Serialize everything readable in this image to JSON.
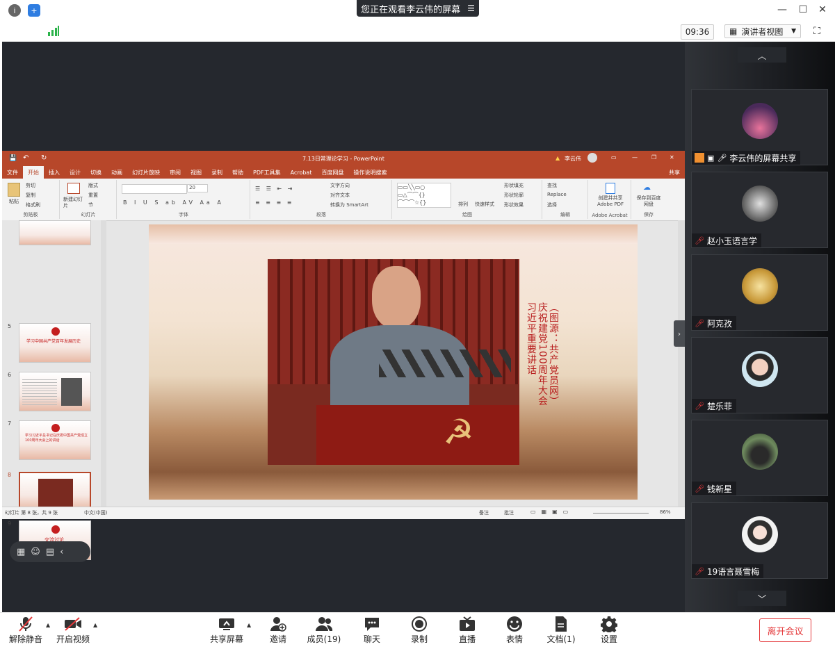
{
  "banner": {
    "text": "您正在观看李云伟的屏幕"
  },
  "infobar": {
    "clock": "09:36",
    "view_label": "演讲者视图"
  },
  "ppt": {
    "title": "7.13日常理论学习  -  PowerPoint",
    "user": "李云伟",
    "menu": [
      "文件",
      "开始",
      "插入",
      "设计",
      "切换",
      "动画",
      "幻灯片放映",
      "审阅",
      "视图",
      "录制",
      "帮助",
      "PDF工具集",
      "Acrobat",
      "百度网盘",
      "操作说明搜索"
    ],
    "share": "共享",
    "ribbon": {
      "clipboard": {
        "name": "剪贴板",
        "paste": "粘贴",
        "cut": "剪切",
        "copy": "复制",
        "format": "格式刷"
      },
      "slides": {
        "name": "幻灯片",
        "new": "新建幻灯片",
        "layout": "版式",
        "reset": "重置",
        "section": "节"
      },
      "font": {
        "name": "字体",
        "size": "20"
      },
      "paragraph": {
        "name": "段落",
        "direction": "文字方向",
        "align": "对齐文本",
        "smartart": "转换为 SmartArt"
      },
      "drawing": {
        "name": "绘图",
        "arrange": "排列",
        "quickstyle": "快速样式",
        "fill": "形状填充",
        "outline": "形状轮廓",
        "effect": "形状效果"
      },
      "editing": {
        "name": "编辑",
        "find": "查找",
        "replace": "Replace",
        "select": "选择"
      },
      "acrobat": {
        "name": "Adobe Acrobat",
        "create": "创建并共享 Adobe PDF"
      },
      "save": {
        "name": "保存",
        "save_to": "保存到百度网盘"
      }
    },
    "thumbs": [
      {
        "num": "5",
        "text": "学习中国共产党百年发展历史"
      },
      {
        "num": "6",
        "text": ""
      },
      {
        "num": "7",
        "text": "学习习近平总书记在庆祝中国共产党成立100周年大会上的讲话"
      },
      {
        "num": "8",
        "text": ""
      },
      {
        "num": "9",
        "text": "交流讨论"
      }
    ],
    "slide": {
      "caption_main": "庆祝建党100周年大会习近平重要讲话",
      "caption_source": "（图源：共产党员网）"
    },
    "status": {
      "slide_info": "幻灯片 第 8 张，共 9 张",
      "lang": "中文(中国)",
      "notes": "备注",
      "comments": "批注",
      "zoom": "86%"
    }
  },
  "participants": [
    {
      "name": "李云伟的屏幕共享",
      "type": "share",
      "avatar_color": "#9b6b8a"
    },
    {
      "name": "赵小玉语言学",
      "type": "muted",
      "avatar_color": "#dcdcdc"
    },
    {
      "name": "阿克孜",
      "type": "muted",
      "avatar_color": "#d9b34a"
    },
    {
      "name": "楚乐菲",
      "type": "muted",
      "avatar_color": "#cfe6f0"
    },
    {
      "name": "钱新星",
      "type": "muted",
      "avatar_color": "#6e8a5e"
    },
    {
      "name": "19语言聂雪梅",
      "type": "muted",
      "avatar_color": "#f2f2f2"
    }
  ],
  "toolbar": {
    "unmute": "解除静音",
    "video": "开启视频",
    "share": "共享屏幕",
    "invite": "邀请",
    "members": "成员(19)",
    "chat": "聊天",
    "record": "录制",
    "live": "直播",
    "emoji": "表情",
    "docs": "文档(1)",
    "settings": "设置",
    "leave": "离开会议"
  }
}
